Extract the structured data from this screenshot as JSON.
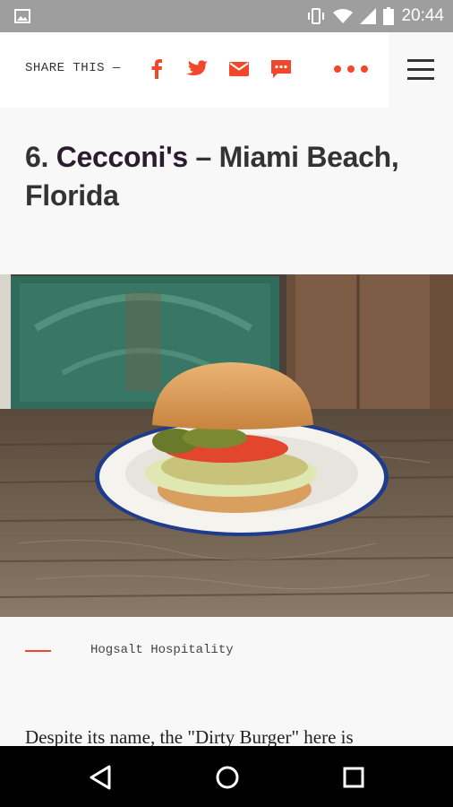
{
  "status_bar": {
    "time": "20:44",
    "icons": [
      "image-icon",
      "vibrate-icon",
      "wifi-icon",
      "signal-icon",
      "battery-icon"
    ]
  },
  "share_bar": {
    "label": "SHARE THIS —",
    "icons": [
      "facebook-icon",
      "twitter-icon",
      "email-icon",
      "sms-icon",
      "more-icon",
      "menu-icon"
    ],
    "accent_color": "#f2472a"
  },
  "article": {
    "title_number": "6.",
    "title_name": "Cecconi's",
    "title_rest": "– Miami Beach, Florida",
    "photo_credit": "Hogsalt Hospitality",
    "body_start": "Despite its name, the \"Dirty Burger\" here is"
  },
  "nav_bar": {
    "buttons": [
      "back-icon",
      "home-icon",
      "recents-icon"
    ]
  }
}
